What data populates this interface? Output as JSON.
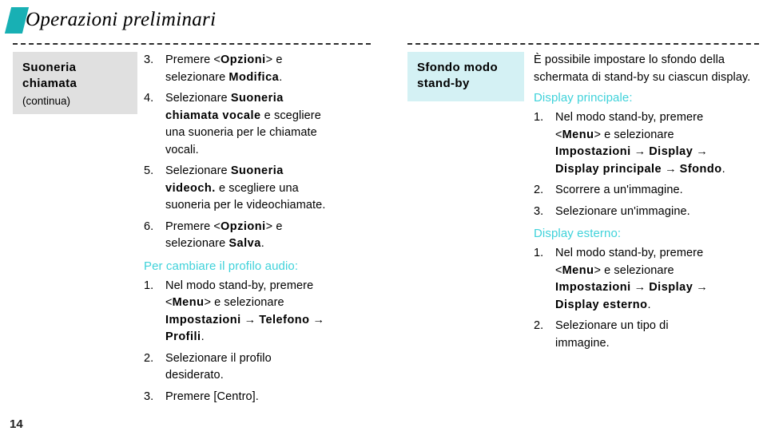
{
  "header": {
    "title": "Operazioni preliminari",
    "accent_color": "#18b0b4"
  },
  "theme": {
    "subheading_color": "#3fd2da",
    "gray_box_color": "#e0e0e0",
    "cyan_box_color": "#d4f1f4"
  },
  "footer": {
    "page_number": "14"
  },
  "left_column": {
    "label": {
      "title_line1": "Suoneria",
      "title_line2": "chiamata",
      "subtitle": "(continua)"
    },
    "steps_top": [
      {
        "num": "3.",
        "parts": [
          {
            "t": "Premere <",
            "b": false
          },
          {
            "t": "Opzioni",
            "b": true
          },
          {
            "t": "> e",
            "b": false
          },
          {
            "t": "selezionare ",
            "b": false,
            "break_before": true
          },
          {
            "t": "Modifica",
            "b": true
          },
          {
            "t": ".",
            "b": false
          }
        ]
      },
      {
        "num": "4.",
        "parts": [
          {
            "t": "Selezionare ",
            "b": false
          },
          {
            "t": "Suoneria",
            "b": true
          },
          {
            "t": "chiamata vocale",
            "b": true,
            "break_before": true
          },
          {
            "t": " e scegliere",
            "b": false
          },
          {
            "t": "una suoneria per le chiamate",
            "b": false,
            "break_before": true
          },
          {
            "t": "vocali.",
            "b": false,
            "break_before": true
          }
        ]
      },
      {
        "num": "5.",
        "parts": [
          {
            "t": "Selezionare ",
            "b": false
          },
          {
            "t": "Suoneria",
            "b": true
          },
          {
            "t": "videoch.",
            "b": true,
            "break_before": true
          },
          {
            "t": " e scegliere una",
            "b": false
          },
          {
            "t": "suoneria per le videochiamate.",
            "b": false,
            "break_before": true
          }
        ]
      },
      {
        "num": "6.",
        "parts": [
          {
            "t": "Premere <",
            "b": false
          },
          {
            "t": "Opzioni",
            "b": true
          },
          {
            "t": "> e",
            "b": false
          },
          {
            "t": "selezionare ",
            "b": false,
            "break_before": true
          },
          {
            "t": "Salva",
            "b": true
          },
          {
            "t": ".",
            "b": false
          }
        ]
      }
    ],
    "subheading": "Per cambiare il profilo audio:",
    "steps_bottom": [
      {
        "num": "1.",
        "parts": [
          {
            "t": "Nel modo stand-by, premere",
            "b": false
          },
          {
            "t": "<",
            "b": false,
            "break_before": true
          },
          {
            "t": "Menu",
            "b": true
          },
          {
            "t": "> e selezionare",
            "b": false
          },
          {
            "t": "Impostazioni",
            "b": true,
            "break_before": true
          },
          {
            "t": " → ",
            "b": false,
            "arrow": true
          },
          {
            "t": "Telefono",
            "b": true
          },
          {
            "t": " →",
            "b": false,
            "arrow": true
          },
          {
            "t": "Profili",
            "b": true,
            "break_before": true
          },
          {
            "t": ".",
            "b": false
          }
        ]
      },
      {
        "num": "2.",
        "parts": [
          {
            "t": "Selezionare il profilo",
            "b": false
          },
          {
            "t": "desiderato.",
            "b": false,
            "break_before": true
          }
        ]
      },
      {
        "num": "3.",
        "parts": [
          {
            "t": "Premere [Centro].",
            "b": false
          }
        ]
      }
    ]
  },
  "right_column": {
    "label": {
      "title_line1": "Sfondo modo",
      "title_line2": "stand-by"
    },
    "intro": "È possibile impostare lo sfondo della schermata di stand-by su ciascun display.",
    "section_main": {
      "subheading": "Display principale:",
      "steps": [
        {
          "num": "1.",
          "parts": [
            {
              "t": "Nel modo stand-by, premere",
              "b": false
            },
            {
              "t": "<",
              "b": false,
              "break_before": true
            },
            {
              "t": "Menu",
              "b": true
            },
            {
              "t": "> e selezionare",
              "b": false
            },
            {
              "t": "Impostazioni",
              "b": true,
              "break_before": true
            },
            {
              "t": " → ",
              "b": false,
              "arrow": true
            },
            {
              "t": "Display",
              "b": true
            },
            {
              "t": " →",
              "b": false,
              "arrow": true
            },
            {
              "t": "Display principale",
              "b": true,
              "break_before": true
            },
            {
              "t": " → ",
              "b": false,
              "arrow": true
            },
            {
              "t": "Sfondo",
              "b": true
            },
            {
              "t": ".",
              "b": false
            }
          ]
        },
        {
          "num": "2.",
          "parts": [
            {
              "t": "Scorrere a un'immagine.",
              "b": false
            }
          ]
        },
        {
          "num": "3.",
          "parts": [
            {
              "t": "Selezionare un'immagine.",
              "b": false
            }
          ]
        }
      ]
    },
    "section_external": {
      "subheading": "Display esterno:",
      "steps": [
        {
          "num": "1.",
          "parts": [
            {
              "t": "Nel modo stand-by, premere",
              "b": false
            },
            {
              "t": "<",
              "b": false,
              "break_before": true
            },
            {
              "t": "Menu",
              "b": true
            },
            {
              "t": "> e selezionare",
              "b": false
            },
            {
              "t": "Impostazioni",
              "b": true,
              "break_before": true
            },
            {
              "t": " → ",
              "b": false,
              "arrow": true
            },
            {
              "t": "Display",
              "b": true
            },
            {
              "t": " →",
              "b": false,
              "arrow": true
            },
            {
              "t": "Display esterno",
              "b": true,
              "break_before": true
            },
            {
              "t": ".",
              "b": false
            }
          ]
        },
        {
          "num": "2.",
          "parts": [
            {
              "t": "Selezionare un tipo di",
              "b": false
            },
            {
              "t": "immagine.",
              "b": false,
              "break_before": true
            }
          ]
        }
      ]
    }
  }
}
